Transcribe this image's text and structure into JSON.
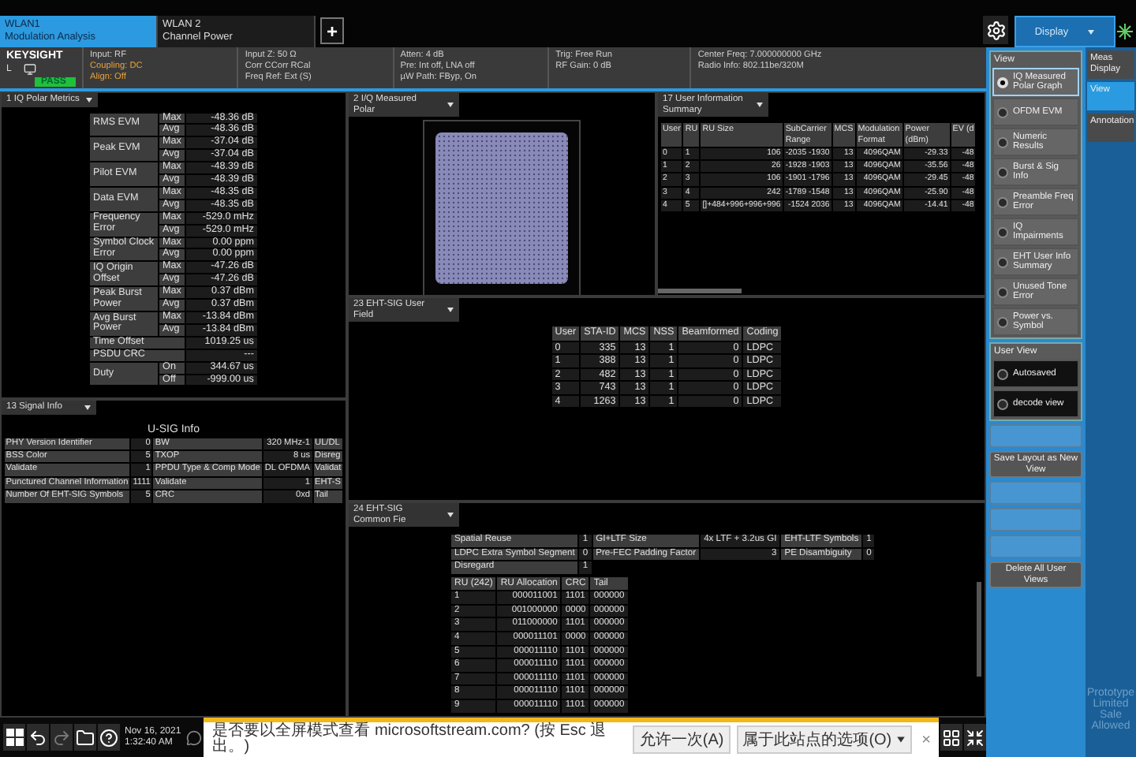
{
  "tabs": [
    {
      "title": "WLAN1",
      "subtitle": "Modulation Analysis",
      "selected": true
    },
    {
      "title": "WLAN 2",
      "subtitle": "Channel Power",
      "selected": false
    }
  ],
  "add_tab": "+",
  "display_menu": {
    "label": "Display"
  },
  "status": {
    "brand": "KEYSIGHT",
    "channel": "L",
    "verdict": "PASS",
    "columns": [
      [
        {
          "text": "Input: RF",
          "warning": false
        },
        {
          "text": "Coupling: DC",
          "warning": true
        },
        {
          "text": "Align: Off",
          "warning": true
        }
      ],
      [
        {
          "text": "Input Z: 50 Ω",
          "warning": false
        },
        {
          "text": "Corr CCorr RCal",
          "warning": false
        },
        {
          "text": "Freq Ref: Ext (S)",
          "warning": false
        }
      ],
      [
        {
          "text": "Atten: 4 dB",
          "warning": false
        },
        {
          "text": "Pre: Int off, LNA off",
          "warning": false
        },
        {
          "text": "µW Path: FByp, On",
          "warning": false
        }
      ],
      [
        {
          "text": "Trig: Free Run",
          "warning": false
        },
        {
          "text": "RF Gain: 0 dB",
          "warning": false
        }
      ],
      [
        {
          "text": "Center Freq: 7.000000000 GHz",
          "warning": false
        },
        {
          "text": "Radio Info: 802.11be/320M",
          "warning": false
        }
      ]
    ]
  },
  "iq_metrics": {
    "title": "1 IQ Polar Metrics",
    "rows": [
      {
        "label": "RMS EVM",
        "values": [
          {
            "stat": "Max",
            "value": "-48.36 dB"
          },
          {
            "stat": "Avg",
            "value": "-48.36 dB"
          }
        ]
      },
      {
        "label": "Peak EVM",
        "values": [
          {
            "stat": "Max",
            "value": "-37.04 dB"
          },
          {
            "stat": "Avg",
            "value": "-37.04 dB"
          }
        ]
      },
      {
        "label": "Pilot EVM",
        "values": [
          {
            "stat": "Max",
            "value": "-48.39 dB"
          },
          {
            "stat": "Avg",
            "value": "-48.39 dB"
          }
        ]
      },
      {
        "label": "Data EVM",
        "values": [
          {
            "stat": "Max",
            "value": "-48.35 dB"
          },
          {
            "stat": "Avg",
            "value": "-48.35 dB"
          }
        ]
      },
      {
        "label": "Frequency Error",
        "values": [
          {
            "stat": "Max",
            "value": "-529.0 mHz"
          },
          {
            "stat": "Avg",
            "value": "-529.0 mHz"
          }
        ]
      },
      {
        "label": "Symbol Clock Error",
        "values": [
          {
            "stat": "Max",
            "value": "0.00 ppm"
          },
          {
            "stat": "Avg",
            "value": "0.00 ppm"
          }
        ]
      },
      {
        "label": "IQ Origin Offset",
        "values": [
          {
            "stat": "Max",
            "value": "-47.26 dB"
          },
          {
            "stat": "Avg",
            "value": "-47.26 dB"
          }
        ]
      },
      {
        "label": "Peak Burst Power",
        "values": [
          {
            "stat": "Max",
            "value": "0.37 dBm"
          },
          {
            "stat": "Avg",
            "value": "0.37 dBm"
          }
        ]
      },
      {
        "label": "Avg Burst Power",
        "values": [
          {
            "stat": "Max",
            "value": "-13.84 dBm"
          },
          {
            "stat": "Avg",
            "value": "-13.84 dBm"
          }
        ]
      },
      {
        "label": "Time Offset",
        "values": [
          {
            "value": "1019.25 us"
          }
        ]
      },
      {
        "label": "PSDU CRC",
        "values": [
          {
            "value": "---"
          }
        ]
      },
      {
        "label": "Duty",
        "values": [
          {
            "stat": "On",
            "value": "344.67 us"
          },
          {
            "stat": "Off",
            "value": "-999.00 us"
          }
        ]
      }
    ]
  },
  "polar": {
    "title": "2 I/Q Measured Polar"
  },
  "user_summary": {
    "title": "17 User Information Summary",
    "columns": [
      {
        "label": "User"
      },
      {
        "label": "RU"
      },
      {
        "label": "RU Size"
      },
      {
        "label": "SubCarrier Range"
      },
      {
        "label": "MCS"
      },
      {
        "label": "Modulation Format"
      },
      {
        "label": "Power (dBm)"
      },
      {
        "label": "EV (d"
      }
    ],
    "rows": [
      [
        "0",
        "1",
        "106",
        "-2035 -1930",
        "13",
        "4096QAM",
        "-29.33",
        "-48"
      ],
      [
        "1",
        "2",
        "26",
        "-1928 -1903",
        "13",
        "4096QAM",
        "-35.56",
        "-48"
      ],
      [
        "2",
        "3",
        "106",
        "-1901 -1796",
        "13",
        "4096QAM",
        "-29.45",
        "-48"
      ],
      [
        "3",
        "4",
        "242",
        "-1789 -1548",
        "13",
        "4096QAM",
        "-25.90",
        "-48"
      ],
      [
        "4",
        "5",
        "[]+484+996+996+996",
        "-1524 2036",
        "13",
        "4096QAM",
        "-14.41",
        "-48"
      ]
    ]
  },
  "user_field": {
    "title": "23 EHT-SIG User Field",
    "columns": [
      "User",
      "STA-ID",
      "MCS",
      "NSS",
      "Beamformed",
      "Coding"
    ],
    "rows": [
      [
        "0",
        "335",
        "13",
        "1",
        "0",
        "LDPC"
      ],
      [
        "1",
        "388",
        "13",
        "1",
        "0",
        "LDPC"
      ],
      [
        "2",
        "482",
        "13",
        "1",
        "0",
        "LDPC"
      ],
      [
        "3",
        "743",
        "13",
        "1",
        "0",
        "LDPC"
      ],
      [
        "4",
        "1263",
        "13",
        "1",
        "0",
        "LDPC"
      ]
    ]
  },
  "signal_info": {
    "title": "13 Signal Info",
    "table_title": "U-SIG Info",
    "rows": [
      [
        "PHY Version Identifier",
        "0",
        "BW",
        "320 MHz-1",
        "UL/DL"
      ],
      [
        "BSS Color",
        "5",
        "TXOP",
        "8 us",
        "Disreg"
      ],
      [
        "Validate",
        "1",
        "PPDU Type & Comp Mode",
        "DL OFDMA",
        "Validat"
      ],
      [
        "Punctured Channel Information",
        "1111",
        "Validate",
        "1",
        "EHT-S"
      ],
      [
        "Number Of EHT-SIG Symbols",
        "5",
        "CRC",
        "0xd",
        "Tail"
      ]
    ]
  },
  "common_field": {
    "title": "24 EHT-SIG Common Fie",
    "params": [
      [
        "Spatial Reuse",
        "1",
        "GI+LTF Size",
        "4x LTF + 3.2us GI",
        "EHT-LTF Symbols",
        "1"
      ],
      [
        "LDPC Extra Symbol Segment",
        "0",
        "Pre-FEC Padding Factor",
        "3",
        "PE Disambiguity",
        "0"
      ],
      [
        "Disregard",
        "1"
      ]
    ],
    "ru_columns": [
      "RU (242)",
      "RU Allocation",
      "CRC",
      "Tail"
    ],
    "ru_rows": [
      [
        "1",
        "000011001",
        "1101",
        "000000"
      ],
      [
        "2",
        "001000000",
        "0000",
        "000000"
      ],
      [
        "3",
        "011000000",
        "1101",
        "000000"
      ],
      [
        "4",
        "000011101",
        "0000",
        "000000"
      ],
      [
        "5",
        "000011110",
        "1101",
        "000000"
      ],
      [
        "6",
        "000011110",
        "1101",
        "000000"
      ],
      [
        "7",
        "000011110",
        "1101",
        "000000"
      ],
      [
        "8",
        "000011110",
        "1101",
        "000000"
      ],
      [
        "9",
        "000011110",
        "1101",
        "000000"
      ]
    ]
  },
  "side_panel": {
    "view_title": "View",
    "views": [
      {
        "label": "IQ Measured Polar Graph",
        "selected": true
      },
      {
        "label": "OFDM EVM",
        "selected": false
      },
      {
        "label": "Numeric Results",
        "selected": false
      },
      {
        "label": "Burst & Sig Info",
        "selected": false
      },
      {
        "label": "Preamble Freq Error",
        "selected": false
      },
      {
        "label": "IQ Impairments",
        "selected": false
      },
      {
        "label": "EHT User Info Summary",
        "selected": false
      },
      {
        "label": "Unused Tone Error",
        "selected": false
      },
      {
        "label": "Power vs. Symbol",
        "selected": false
      }
    ],
    "side_tabs": [
      {
        "label": "Meas Display",
        "selected": false
      },
      {
        "label": "View",
        "selected": true
      },
      {
        "label": "Annotation",
        "selected": false
      }
    ],
    "user_view_title": "User View",
    "user_views": [
      {
        "label": "Autosaved",
        "selected": false
      },
      {
        "label": "decode view",
        "selected": false
      }
    ],
    "buttons": [
      {
        "disabled": true
      },
      {
        "label": "Save Layout as New View",
        "disabled": false
      },
      {
        "disabled": true
      },
      {
        "disabled": true
      },
      {
        "disabled": true
      },
      {
        "label": "Delete All User Views",
        "disabled": false
      }
    ],
    "license_note": "Prototype Limited Sale Allowed"
  },
  "taskbar": {
    "date": "Nov 16, 2021",
    "time": "1:32:40 AM"
  },
  "notification": {
    "message": "是否要以全屏模式查看 microsoftstream.com? (按 Esc 退出。)",
    "buttons": [
      "允许一次(A)",
      "属于此站点的选项(O)"
    ],
    "close": "×"
  }
}
